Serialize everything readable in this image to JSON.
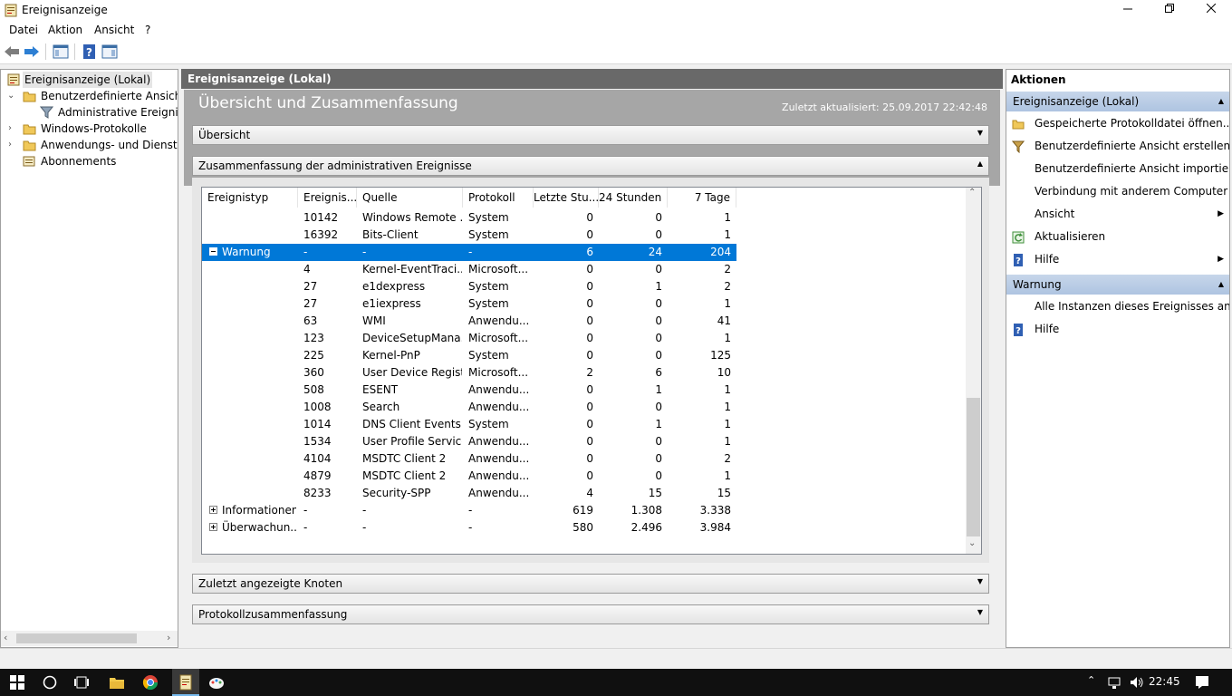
{
  "window": {
    "title": "Ereignisanzeige"
  },
  "menu": [
    "Datei",
    "Aktion",
    "Ansicht",
    "?"
  ],
  "tree": {
    "items": [
      {
        "label": "Ereignisanzeige (Lokal)",
        "indent": 0,
        "expander": ""
      },
      {
        "label": "Benutzerdefinierte Ansichten",
        "indent": 1,
        "expander": "v"
      },
      {
        "label": "Administrative Ereignisse",
        "indent": 2,
        "expander": ""
      },
      {
        "label": "Windows-Protokolle",
        "indent": 1,
        "expander": ">"
      },
      {
        "label": "Anwendungs- und Dienstprotokolle",
        "indent": 1,
        "expander": ">"
      },
      {
        "label": "Abonnements",
        "indent": 1,
        "expander": ""
      }
    ]
  },
  "center": {
    "header": "Ereignisanzeige (Lokal)",
    "overview_title": "Übersicht und Zusammenfassung",
    "last_updated": "Zuletzt aktualisiert: 25.09.2017 22:42:48",
    "sections": {
      "overview": "Übersicht",
      "summary": "Zusammenfassung der administrativen Ereignisse",
      "recent_nodes": "Zuletzt angezeigte Knoten",
      "log_summary": "Protokollzusammenfassung"
    },
    "grid": {
      "columns": [
        "Ereignistyp",
        "Ereignis...",
        "Quelle",
        "Protokoll",
        "Letzte Stu...",
        "24 Stunden",
        "7 Tage"
      ],
      "rows": [
        {
          "type": "",
          "id": "10142",
          "source": "Windows Remote ...",
          "log": "System",
          "h1": "0",
          "h24": "0",
          "d7": "1"
        },
        {
          "type": "",
          "id": "16392",
          "source": "Bits-Client",
          "log": "System",
          "h1": "0",
          "h24": "0",
          "d7": "1"
        },
        {
          "type": "Warnung",
          "id": "-",
          "source": "-",
          "log": "-",
          "h1": "6",
          "h24": "24",
          "d7": "204",
          "group": "minus",
          "selected": true
        },
        {
          "type": "",
          "id": "4",
          "source": "Kernel-EventTraci...",
          "log": "Microsoft...",
          "h1": "0",
          "h24": "0",
          "d7": "2"
        },
        {
          "type": "",
          "id": "27",
          "source": "e1dexpress",
          "log": "System",
          "h1": "0",
          "h24": "1",
          "d7": "2"
        },
        {
          "type": "",
          "id": "27",
          "source": "e1iexpress",
          "log": "System",
          "h1": "0",
          "h24": "0",
          "d7": "1"
        },
        {
          "type": "",
          "id": "63",
          "source": "WMI",
          "log": "Anwendu...",
          "h1": "0",
          "h24": "0",
          "d7": "41"
        },
        {
          "type": "",
          "id": "123",
          "source": "DeviceSetupMana...",
          "log": "Microsoft...",
          "h1": "0",
          "h24": "0",
          "d7": "1"
        },
        {
          "type": "",
          "id": "225",
          "source": "Kernel-PnP",
          "log": "System",
          "h1": "0",
          "h24": "0",
          "d7": "125"
        },
        {
          "type": "",
          "id": "360",
          "source": "User Device Regist...",
          "log": "Microsoft...",
          "h1": "2",
          "h24": "6",
          "d7": "10"
        },
        {
          "type": "",
          "id": "508",
          "source": "ESENT",
          "log": "Anwendu...",
          "h1": "0",
          "h24": "1",
          "d7": "1"
        },
        {
          "type": "",
          "id": "1008",
          "source": "Search",
          "log": "Anwendu...",
          "h1": "0",
          "h24": "0",
          "d7": "1"
        },
        {
          "type": "",
          "id": "1014",
          "source": "DNS Client Events",
          "log": "System",
          "h1": "0",
          "h24": "1",
          "d7": "1"
        },
        {
          "type": "",
          "id": "1534",
          "source": "User Profile Service",
          "log": "Anwendu...",
          "h1": "0",
          "h24": "0",
          "d7": "1"
        },
        {
          "type": "",
          "id": "4104",
          "source": "MSDTC Client 2",
          "log": "Anwendu...",
          "h1": "0",
          "h24": "0",
          "d7": "2"
        },
        {
          "type": "",
          "id": "4879",
          "source": "MSDTC Client 2",
          "log": "Anwendu...",
          "h1": "0",
          "h24": "0",
          "d7": "1"
        },
        {
          "type": "",
          "id": "8233",
          "source": "Security-SPP",
          "log": "Anwendu...",
          "h1": "4",
          "h24": "15",
          "d7": "15"
        },
        {
          "type": "Informationen",
          "id": "-",
          "source": "-",
          "log": "-",
          "h1": "619",
          "h24": "1.308",
          "d7": "3.338",
          "group": "plus"
        },
        {
          "type": "Überwachun...",
          "id": "-",
          "source": "-",
          "log": "-",
          "h1": "580",
          "h24": "2.496",
          "d7": "3.984",
          "group": "plus"
        }
      ]
    }
  },
  "actions": {
    "header": "Aktionen",
    "group1": "Ereignisanzeige (Lokal)",
    "group1_items": [
      {
        "label": "Gespeicherte Protokolldatei öffnen...",
        "icon": "folder-icon",
        "submenu": false
      },
      {
        "label": "Benutzerdefinierte Ansicht erstellen...",
        "icon": "filter-icon",
        "submenu": false
      },
      {
        "label": "Benutzerdefinierte Ansicht importieren...",
        "icon": "",
        "submenu": false
      },
      {
        "label": "Verbindung mit anderem Computer herstellen...",
        "icon": "",
        "submenu": false
      },
      {
        "label": "Ansicht",
        "icon": "",
        "submenu": true
      },
      {
        "label": "Aktualisieren",
        "icon": "refresh-icon",
        "submenu": false
      },
      {
        "label": "Hilfe",
        "icon": "help-icon",
        "submenu": true
      }
    ],
    "group2": "Warnung",
    "group2_items": [
      {
        "label": "Alle Instanzen dieses Ereignisses anzeigen",
        "icon": "",
        "submenu": false
      },
      {
        "label": "Hilfe",
        "icon": "help-icon",
        "submenu": false
      }
    ]
  },
  "taskbar": {
    "time": "22:45"
  },
  "colors": {
    "selection": "#0078d7",
    "header_dark": "#696969",
    "band_gray": "#a6a6a6",
    "action_group": "#b9cde6"
  }
}
